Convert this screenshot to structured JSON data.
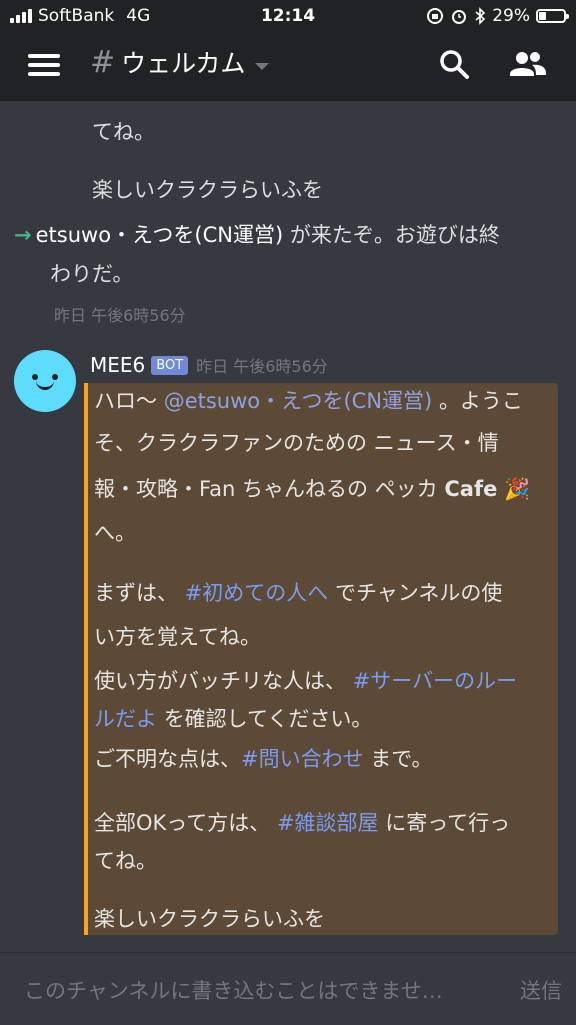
{
  "status": {
    "carrier": "SoftBank",
    "network": "4G",
    "time": "12:14",
    "battery": "29%",
    "battery_level": 0.29
  },
  "header": {
    "channel_name": "ウェルカム",
    "hash": "#"
  },
  "messages": {
    "prev_line1": "てね。",
    "prev_line2": "楽しいクラクラらいふを",
    "join_user": "etsuwo・えつを(CN運営)",
    "join_text_a": " が来たぞ。お遊びは終",
    "join_text_b": "わりだ。",
    "join_time": "昨日 午後6時56分",
    "author": "MEE6",
    "bot_tag": "BOT",
    "time": "昨日 午後6時56分",
    "embed_color": "#f5a623",
    "embed": {
      "l1a": "ハロ〜",
      "l1m": "@etsuwo・えつを(CN運営)",
      "l1b": "。ようこ",
      "l2": "そ、クラクラファンのための ニュース・情",
      "l3a": "報・攻略・Fan ちゃんねるの ペッカ",
      "l3b": "Cafe",
      "l3c": "🎉",
      "l4": "へ。",
      "l5a": "まずは、",
      "l5c": "#初めての人へ",
      "l5b": "でチャンネルの使",
      "l6": "い方を覚えてね。",
      "l7a": "使い方がバッチリな人は、",
      "l7c": "#サーバーのルー",
      "l8c": "ルだよ",
      "l8b": "を確認してください。",
      "l9a": "ご不明な点は、",
      "l9c": "#問い合わせ",
      "l9b": "まで。",
      "l10a": "全部OKって方は、",
      "l10c": "#雑談部屋",
      "l10b": "に寄って行っ",
      "l11": "てね。",
      "l12": "楽しいクラクラらいふを"
    }
  },
  "input": {
    "placeholder": "このチャンネルに書き込むことはできませ…",
    "send_label": "送信"
  },
  "icons": [
    "menu-icon",
    "search-icon",
    "members-icon",
    "alarm-icon",
    "bluetooth-icon",
    "orientation-lock-icon",
    "battery-icon",
    "signal-icon",
    "party-popper-icon"
  ]
}
